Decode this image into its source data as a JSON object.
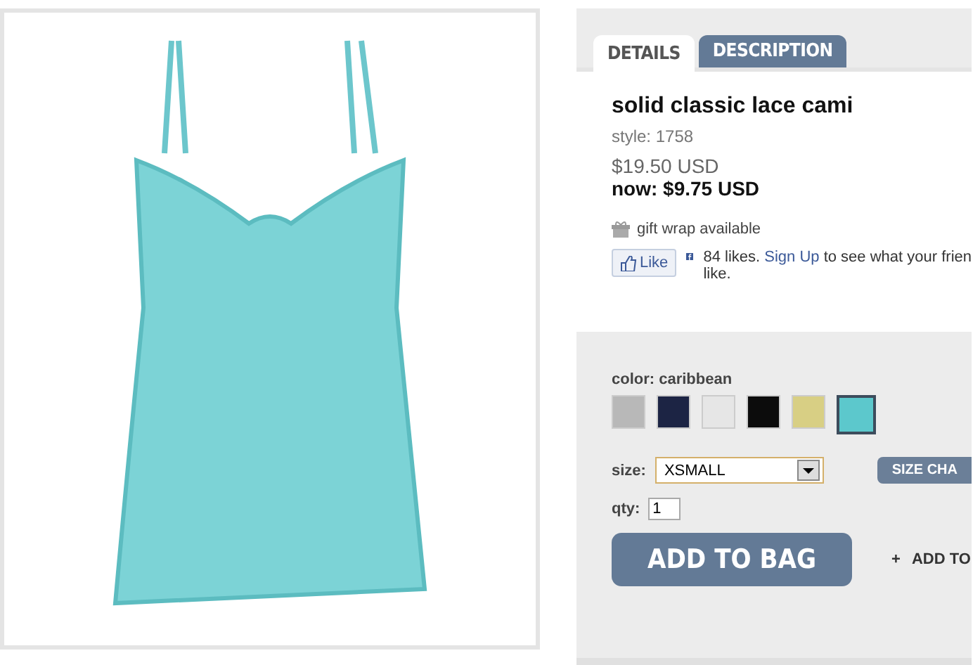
{
  "tabs": [
    {
      "label": "DETAILS",
      "selected": true
    },
    {
      "label": "DESCRIPTION",
      "selected": false
    }
  ],
  "product": {
    "name": "solid classic lace cami",
    "style": "style: 1758",
    "price": "$19.50 USD",
    "sale_price": "now: $9.75 USD",
    "gift_wrap": "gift wrap available"
  },
  "social": {
    "like_button": "Like",
    "likes": "84 likes.",
    "link": "Sign Up",
    "text": "to see what your frien",
    "text_line_2": "like."
  },
  "color": {
    "label": "color: caribbean",
    "swatches": [
      {
        "color": "#b8b8b8",
        "selected": false
      },
      {
        "color": "#1c2444",
        "selected": false
      },
      {
        "color": "#e6e6e6",
        "selected": false
      },
      {
        "color": "#0c0c0c",
        "selected": false
      },
      {
        "color": "#d8cf84",
        "selected": false
      },
      {
        "color": "#5cc8cc",
        "selected": true
      }
    ]
  },
  "size": {
    "label": "size:",
    "value": "XSMALL",
    "chart_button": "SIZE CHA"
  },
  "qty": {
    "label": "qty:",
    "value": "1"
  },
  "add_to_bag": "ADD TO BAG",
  "wishlist": {
    "icon": "+",
    "label": "ADD TO"
  }
}
